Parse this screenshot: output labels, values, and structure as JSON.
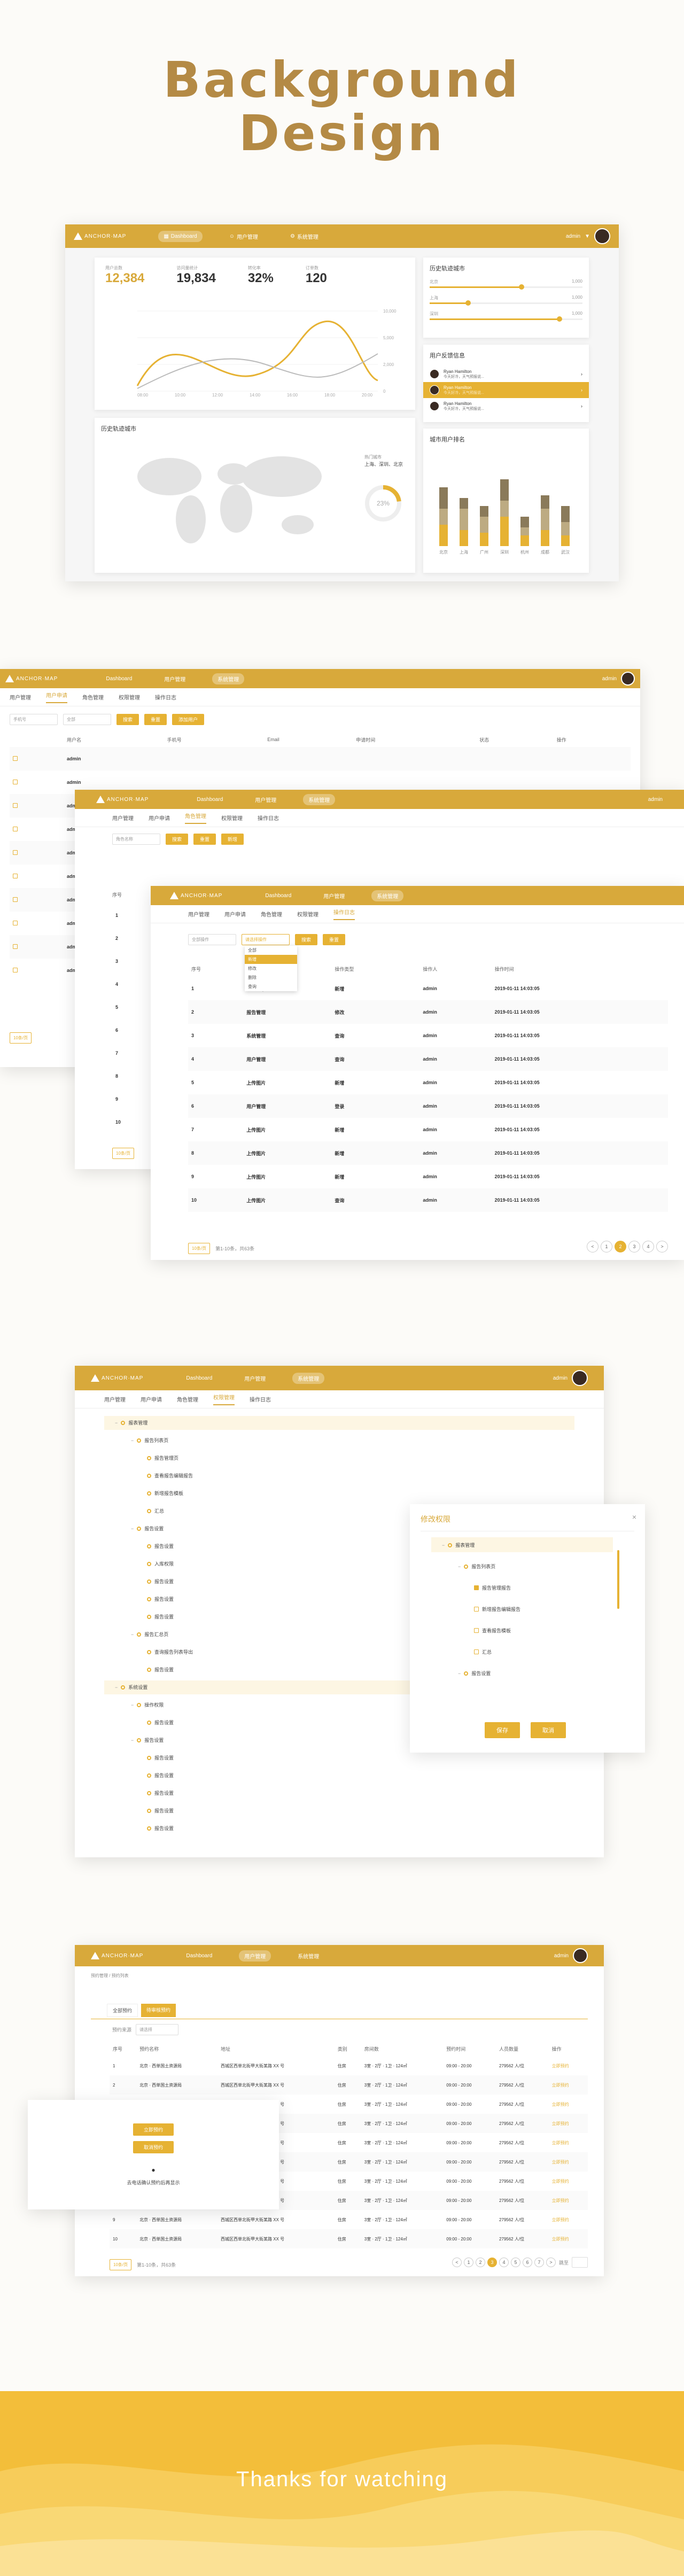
{
  "hero": {
    "title_line1": "Background",
    "title_line2": "Design"
  },
  "brand": {
    "logo_text": "ANCHOR·MAP",
    "accent": "#d8a93b",
    "accent_light": "#e6b233"
  },
  "nav": {
    "dashboard": "Dashboard",
    "users": "用户管理",
    "system": "系统管理",
    "username": "admin"
  },
  "dashboard": {
    "stats": [
      {
        "label": "用户总数",
        "value": "12,384"
      },
      {
        "label": "访问量统计",
        "value": "19,834"
      },
      {
        "label": "转化率",
        "value": "32%"
      },
      {
        "label": "订单数",
        "value": "120"
      }
    ],
    "line_chart": {
      "y_ticks": [
        "10,000",
        "5,000",
        "2,000",
        "0"
      ],
      "x_ticks": [
        "08:00",
        "10:00",
        "12:00",
        "14:00",
        "16:00",
        "18:00",
        "20:00"
      ]
    },
    "sliders_title": "历史轨迹城市",
    "sliders": [
      {
        "label": "北京",
        "max": "1,000",
        "level": 0.6
      },
      {
        "label": "上海",
        "max": "1,000",
        "level": 0.25
      },
      {
        "label": "深圳",
        "max": "1,000",
        "level": 0.85
      }
    ],
    "feedback_title": "用户反馈信息",
    "feedback": [
      {
        "name": "Ryan Hamilton",
        "text": "今天好冷，天气预报说..."
      },
      {
        "name": "Ryan Hamilton",
        "text": "今天好冷，天气预报说..."
      },
      {
        "name": "Ryan Hamilton",
        "text": "今天好冷，天气预报说..."
      }
    ],
    "map_title": "历史轨迹城市",
    "map_legend_title": "热门城市",
    "map_legend_cities": "上海、深圳、北京",
    "donut_value": "23%",
    "donut_fraction": 0.23,
    "bar_title": "城市用户排名",
    "bar_categories": [
      "北京",
      "上海",
      "广州",
      "深圳",
      "杭州",
      "成都",
      "武汉"
    ]
  },
  "users_page": {
    "tabs": [
      "用户管理",
      "用户申请",
      "角色管理",
      "权限管理",
      "操作日志"
    ],
    "search_placeholder": "手机号",
    "search_placeholder2": "全部",
    "btn_search": "搜索",
    "btn_reset": "重置",
    "btn_add": "添加用户",
    "headers": [
      "用户名",
      "手机号",
      "Email",
      "申请时间",
      "状态",
      "操作"
    ],
    "rows": [
      "admin",
      "admin",
      "admin",
      "admin",
      "admin",
      "admin",
      "admin",
      "admin",
      "admin",
      "admin"
    ],
    "page_size": "10条/页"
  },
  "roles_page": {
    "search_placeholder": "角色名称",
    "btn_search": "搜索",
    "btn_reset": "重置",
    "btn_add": "新增",
    "header_no": "序号",
    "nums": [
      "1",
      "2",
      "3",
      "4",
      "5",
      "6",
      "7",
      "8",
      "9",
      "10"
    ],
    "page_size": "10条/页"
  },
  "log_page": {
    "filter_label": "全部操作",
    "filter_dropdown": "请选择操作",
    "dropdown_options": [
      "全部",
      "新增",
      "修改",
      "删除",
      "查询"
    ],
    "btn_search": "搜索",
    "btn_reset": "重置",
    "headers": [
      "序号",
      "模块名称",
      "操作类型",
      "操作人",
      "操作时间"
    ],
    "rows": [
      {
        "no": "1",
        "module": "汇总记录",
        "type": "新增",
        "user": "admin",
        "time": "2019-01-11 14:03:05"
      },
      {
        "no": "2",
        "module": "报告管理",
        "type": "修改",
        "user": "admin",
        "time": "2019-01-11 14:03:05"
      },
      {
        "no": "3",
        "module": "系统管理",
        "type": "查询",
        "user": "admin",
        "time": "2019-01-11 14:03:05"
      },
      {
        "no": "4",
        "module": "用户管理",
        "type": "查询",
        "user": "admin",
        "time": "2019-01-11 14:03:05"
      },
      {
        "no": "5",
        "module": "上传图片",
        "type": "新增",
        "user": "admin",
        "time": "2019-01-11 14:03:05"
      },
      {
        "no": "6",
        "module": "用户管理",
        "type": "登录",
        "user": "admin",
        "time": "2019-01-11 14:03:05"
      },
      {
        "no": "7",
        "module": "上传图片",
        "type": "新增",
        "user": "admin",
        "time": "2019-01-11 14:03:05"
      },
      {
        "no": "8",
        "module": "上传图片",
        "type": "新增",
        "user": "admin",
        "time": "2019-01-11 14:03:05"
      },
      {
        "no": "9",
        "module": "上传图片",
        "type": "新增",
        "user": "admin",
        "time": "2019-01-11 14:03:05"
      },
      {
        "no": "10",
        "module": "上传图片",
        "type": "查询",
        "user": "admin",
        "time": "2019-01-11 14:03:05"
      }
    ],
    "page_size": "10条/页",
    "total_text": "第1-10条，共63条",
    "pages": [
      "<",
      "1",
      "2",
      "3",
      "4",
      ">"
    ]
  },
  "perm_page": {
    "tabs": [
      "用户管理",
      "用户申请",
      "角色管理",
      "权限管理",
      "操作日志"
    ],
    "tree": [
      {
        "label": "报表管理",
        "level": 0,
        "highlight": true
      },
      {
        "label": "报告列表页",
        "level": 1
      },
      {
        "label": "报告管理页",
        "level": 2
      },
      {
        "label": "查看报告编辑报告",
        "level": 2
      },
      {
        "label": "新增报告模板",
        "level": 2
      },
      {
        "label": "汇总",
        "level": 2
      },
      {
        "label": "报告设置",
        "level": 1
      },
      {
        "label": "报告设置",
        "level": 2
      },
      {
        "label": "入库权限",
        "level": 2
      },
      {
        "label": "报告设置",
        "level": 2
      },
      {
        "label": "报告设置",
        "level": 2
      },
      {
        "label": "报告设置",
        "level": 2
      },
      {
        "label": "报告汇总页",
        "level": 1
      },
      {
        "label": "查询报告列表导出",
        "level": 2
      },
      {
        "label": "报告设置",
        "level": 2
      },
      {
        "label": "系统设置",
        "level": 0,
        "highlight": true
      },
      {
        "label": "操作权限",
        "level": 1
      },
      {
        "label": "报告设置",
        "level": 2
      },
      {
        "label": "报告设置",
        "level": 1
      },
      {
        "label": "报告设置",
        "level": 2
      },
      {
        "label": "报告设置",
        "level": 2
      },
      {
        "label": "报告设置",
        "level": 2
      },
      {
        "label": "报告设置",
        "level": 2
      },
      {
        "label": "报告设置",
        "level": 2
      }
    ],
    "modal": {
      "title": "修改权限",
      "tree": [
        {
          "label": "报表管理",
          "level": 0
        },
        {
          "label": "报告列表页",
          "level": 1
        },
        {
          "label": "报告管理报告",
          "level": 2,
          "checked": true
        },
        {
          "label": "新增报告编辑报告",
          "level": 2
        },
        {
          "label": "查看报告模板",
          "level": 2
        },
        {
          "label": "汇总",
          "level": 2
        },
        {
          "label": "报告设置",
          "level": 1
        }
      ],
      "btn_confirm": "保存",
      "btn_cancel": "取消"
    }
  },
  "booking_page": {
    "breadcrumb": "预约管理 / 预约列表",
    "tabs": [
      "全部预约",
      "待审核预约"
    ],
    "filter_label": "预约来源",
    "filter_value": "请选择",
    "headers": [
      "序号",
      "预约名称",
      "地址",
      "类别",
      "房间数",
      "预约时间",
      "人员数量",
      "操作"
    ],
    "rows": [
      {
        "no": "1",
        "name": "北京 · 西单国土资源局",
        "addr": "西城区西单北街甲大街某路 XX 号",
        "cat": "住房",
        "size": "3室 · 2厅 · 1卫 · 124㎡",
        "time": "09:00 - 20:00",
        "people": "279562 人/位",
        "op": "立即预约"
      },
      {
        "no": "2",
        "name": "北京 · 西单国土资源局",
        "addr": "西城区西单北街甲大街某路 XX 号",
        "cat": "住房",
        "size": "3室 · 2厅 · 1卫 · 124㎡",
        "time": "09:00 - 20:00",
        "people": "279562 人/位",
        "op": "立即预约"
      },
      {
        "no": "3",
        "name": "北京 · 西单国土资源局",
        "addr": "西城区西单北街甲大街某路 XX 号",
        "cat": "住房",
        "size": "3室 · 2厅 · 1卫 · 124㎡",
        "time": "09:00 - 20:00",
        "people": "279562 人/位",
        "op": "立即预约"
      },
      {
        "no": "4",
        "name": "北京 · 西单国土资源局",
        "addr": "西城区西单北街甲大街某路 XX 号",
        "cat": "住房",
        "size": "3室 · 2厅 · 1卫 · 124㎡",
        "time": "09:00 - 20:00",
        "people": "279562 人/位",
        "op": "立即预约"
      },
      {
        "no": "5",
        "name": "北京 · 西单国土资源局",
        "addr": "西城区西单北街甲大街某路 XX 号",
        "cat": "住房",
        "size": "3室 · 2厅 · 1卫 · 124㎡",
        "time": "09:00 - 20:00",
        "people": "279562 人/位",
        "op": "立即预约"
      },
      {
        "no": "6",
        "name": "北京 · 西单国土资源局",
        "addr": "西城区西单北街甲大街某路 XX 号",
        "cat": "住房",
        "size": "3室 · 2厅 · 1卫 · 124㎡",
        "time": "09:00 - 20:00",
        "people": "279562 人/位",
        "op": "立即预约"
      },
      {
        "no": "7",
        "name": "北京 · 西单国土资源局",
        "addr": "西城区西单北街甲大街某路 XX 号",
        "cat": "住房",
        "size": "3室 · 2厅 · 1卫 · 124㎡",
        "time": "09:00 - 20:00",
        "people": "279562 人/位",
        "op": "立即预约"
      },
      {
        "no": "8",
        "name": "北京 · 西单国土资源局",
        "addr": "西城区西单北街甲大街某路 XX 号",
        "cat": "住房",
        "size": "3室 · 2厅 · 1卫 · 124㎡",
        "time": "09:00 - 20:00",
        "people": "279562 人/位",
        "op": "立即预约"
      },
      {
        "no": "9",
        "name": "北京 · 西单国土资源局",
        "addr": "西城区西单北街甲大街某路 XX 号",
        "cat": "住房",
        "size": "3室 · 2厅 · 1卫 · 124㎡",
        "time": "09:00 - 20:00",
        "people": "279562 人/位",
        "op": "立即预约"
      },
      {
        "no": "10",
        "name": "北京 · 西单国土资源局",
        "addr": "西城区西单北街甲大街某路 XX 号",
        "cat": "住房",
        "size": "3室 · 2厅 · 1卫 · 124㎡",
        "time": "09:00 - 20:00",
        "people": "279562 人/位",
        "op": "立即预约"
      }
    ],
    "popup": {
      "btn1": "立即预约",
      "btn2": "取消预约",
      "text": "去电话确认预约后再显示"
    },
    "page_size": "10条/页",
    "total_text": "第1-10条，共63条",
    "pages": [
      "<",
      "1",
      "2",
      "3",
      "4",
      "5",
      "6",
      "7",
      ">"
    ],
    "goto": "跳至"
  },
  "footer": {
    "thanks": "Thanks for watching"
  }
}
